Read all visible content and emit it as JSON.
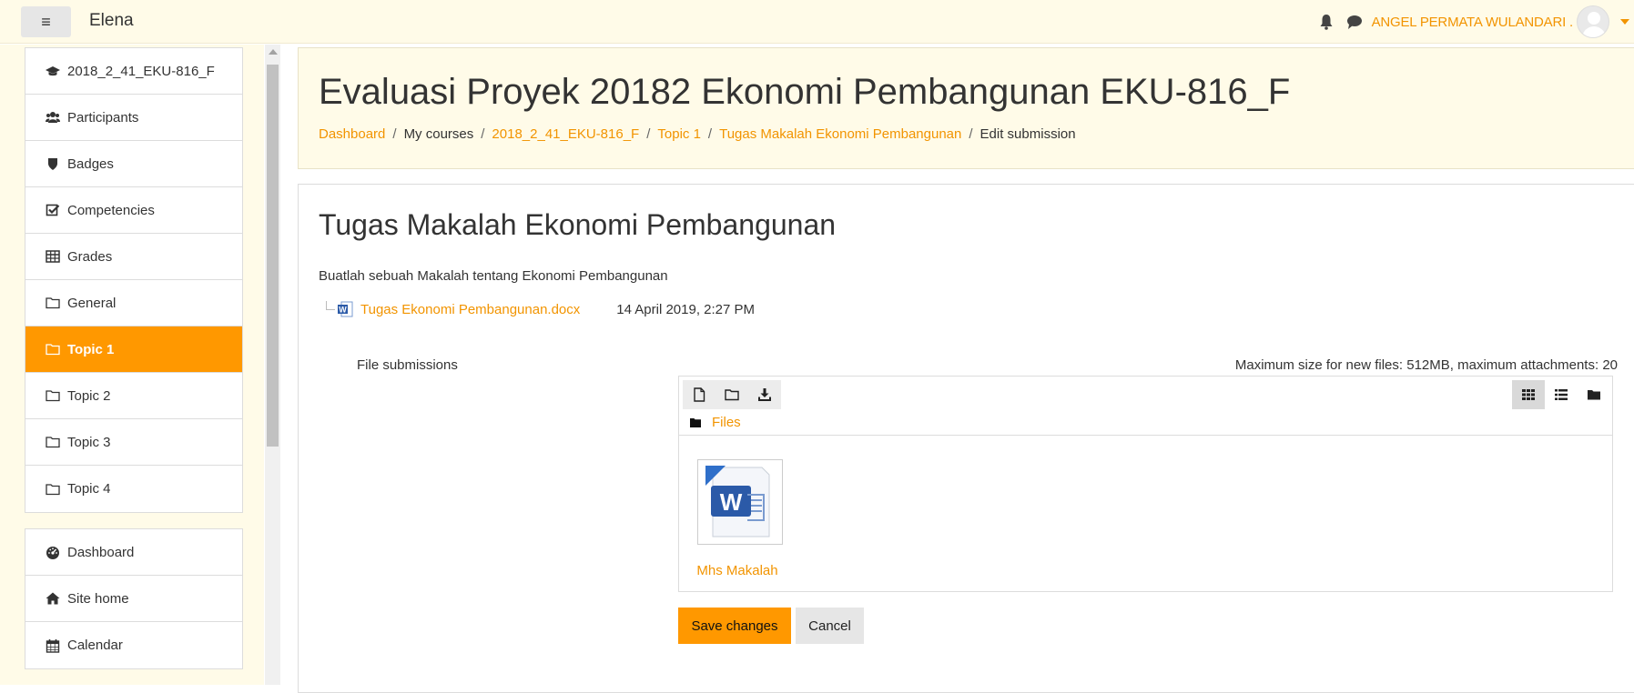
{
  "navbar": {
    "site_name": "Elena",
    "user_name": "ANGEL PERMATA WULANDARI ."
  },
  "sidebar": {
    "course_items": [
      {
        "label": "2018_2_41_EKU-816_F",
        "icon": "graduation-cap-icon"
      },
      {
        "label": "Participants",
        "icon": "users-icon"
      },
      {
        "label": "Badges",
        "icon": "shield-icon"
      },
      {
        "label": "Competencies",
        "icon": "checkbox-icon"
      },
      {
        "label": "Grades",
        "icon": "table-icon"
      },
      {
        "label": "General",
        "icon": "folder-icon"
      },
      {
        "label": "Topic 1",
        "icon": "folder-icon",
        "active": true
      },
      {
        "label": "Topic 2",
        "icon": "folder-icon"
      },
      {
        "label": "Topic 3",
        "icon": "folder-icon"
      },
      {
        "label": "Topic 4",
        "icon": "folder-icon"
      }
    ],
    "site_items": [
      {
        "label": "Dashboard",
        "icon": "dashboard-icon"
      },
      {
        "label": "Site home",
        "icon": "home-icon"
      },
      {
        "label": "Calendar",
        "icon": "calendar-icon"
      }
    ]
  },
  "header": {
    "title": "Evaluasi Proyek 20182 Ekonomi Pembangunan EKU-816_F",
    "breadcrumb": [
      "Dashboard",
      "My courses",
      "2018_2_41_EKU-816_F",
      "Topic 1",
      "Tugas Makalah Ekonomi Pembangunan",
      "Edit submission"
    ]
  },
  "main": {
    "assignment_title": "Tugas Makalah Ekonomi Pembangunan",
    "intro": "Buatlah sebuah Makalah tentang Ekonomi Pembangunan",
    "attachment_name": "Tugas Ekonomi Pembangunan.docx",
    "attachment_date": "14 April 2019, 2:27 PM",
    "file_submissions_label": "File submissions",
    "limits": "Maximum size for new files: 512MB, maximum attachments: 20",
    "path_label": "Files",
    "file_name": "Mhs Makalah",
    "save_label": "Save changes",
    "cancel_label": "Cancel"
  },
  "colors": {
    "accent": "#ff9800",
    "link": "#f29400",
    "header_bg": "#fffbe8"
  }
}
